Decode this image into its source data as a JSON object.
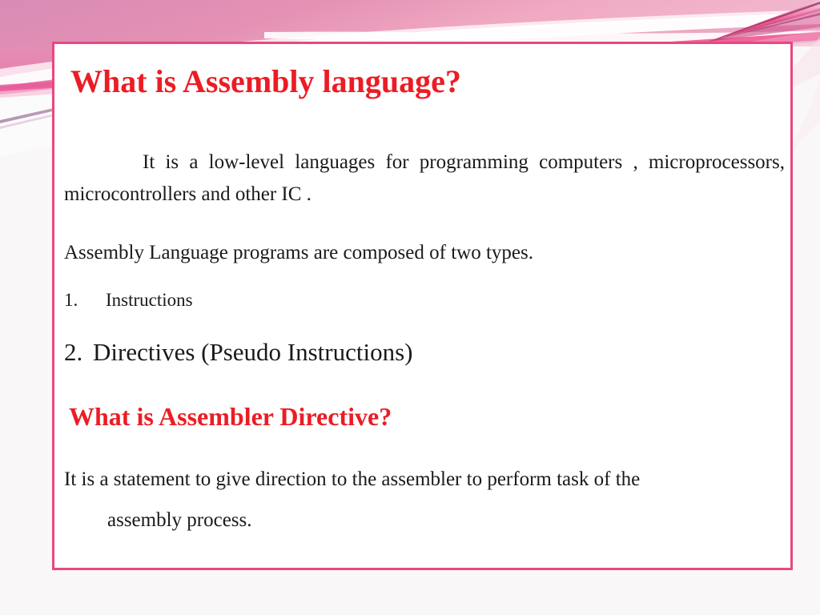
{
  "slide": {
    "title": "What is Assembly language?",
    "subtitle": "What is Assembler Directive?",
    "intro_paragraph": "It is a low-level languages for programming computers , microprocessors, microcontrollers and other IC .",
    "composed_line": "Assembly Language programs are composed of two types.",
    "list": [
      {
        "number": "1.",
        "label": "Instructions"
      },
      {
        "number": "2.",
        "label": "Directives  (Pseudo Instructions)"
      }
    ],
    "closing_line_1": "It is  a statement to give direction to the  assembler to perform task of the",
    "closing_line_2": "assembly process."
  },
  "colors": {
    "title_red": "#ec1c24",
    "frame_border": "#e8487f",
    "band_pink_light": "#f2b9cc",
    "band_pink_mid": "#e087ac",
    "band_pink_deep": "#ec4b86",
    "page_background": "#f9f7f7",
    "body_text": "#1a1a1a"
  }
}
